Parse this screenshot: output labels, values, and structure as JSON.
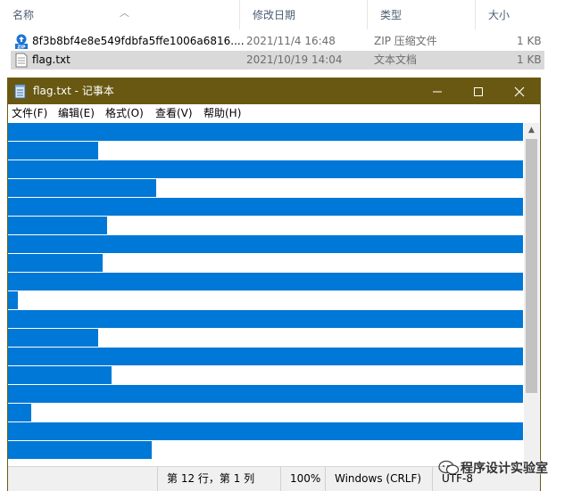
{
  "explorer": {
    "columns": [
      {
        "key": "name",
        "label": "名称"
      },
      {
        "key": "date",
        "label": "修改日期"
      },
      {
        "key": "type",
        "label": "类型"
      },
      {
        "key": "size",
        "label": "大小"
      }
    ],
    "files": [
      {
        "name": "8f3b8bf4e8e549fdbfa5ffe1006a6816....",
        "date": "2021/11/4 16:48",
        "type": "ZIP 压缩文件",
        "size": "1 KB",
        "icon": "zip-file-icon",
        "selected": false
      },
      {
        "name": "flag.txt",
        "date": "2021/10/19 14:04",
        "type": "文本文档",
        "size": "1 KB",
        "icon": "text-file-icon",
        "selected": true
      }
    ]
  },
  "notepad": {
    "title": "flag.txt - 记事本",
    "menu": [
      "文件(F)",
      "编辑(E)",
      "格式(O)",
      "查看(V)",
      "帮助(H)"
    ],
    "selection_color": "#0078d7",
    "titlebar_color": "#685811",
    "status": {
      "position": "第 12 行，第 1 列",
      "zoom": "100%",
      "line_ending": "Windows (CRLF)",
      "encoding": "UTF-8"
    }
  },
  "watermark": {
    "text": "程序设计实验室",
    "icon": "wechat-icon"
  }
}
